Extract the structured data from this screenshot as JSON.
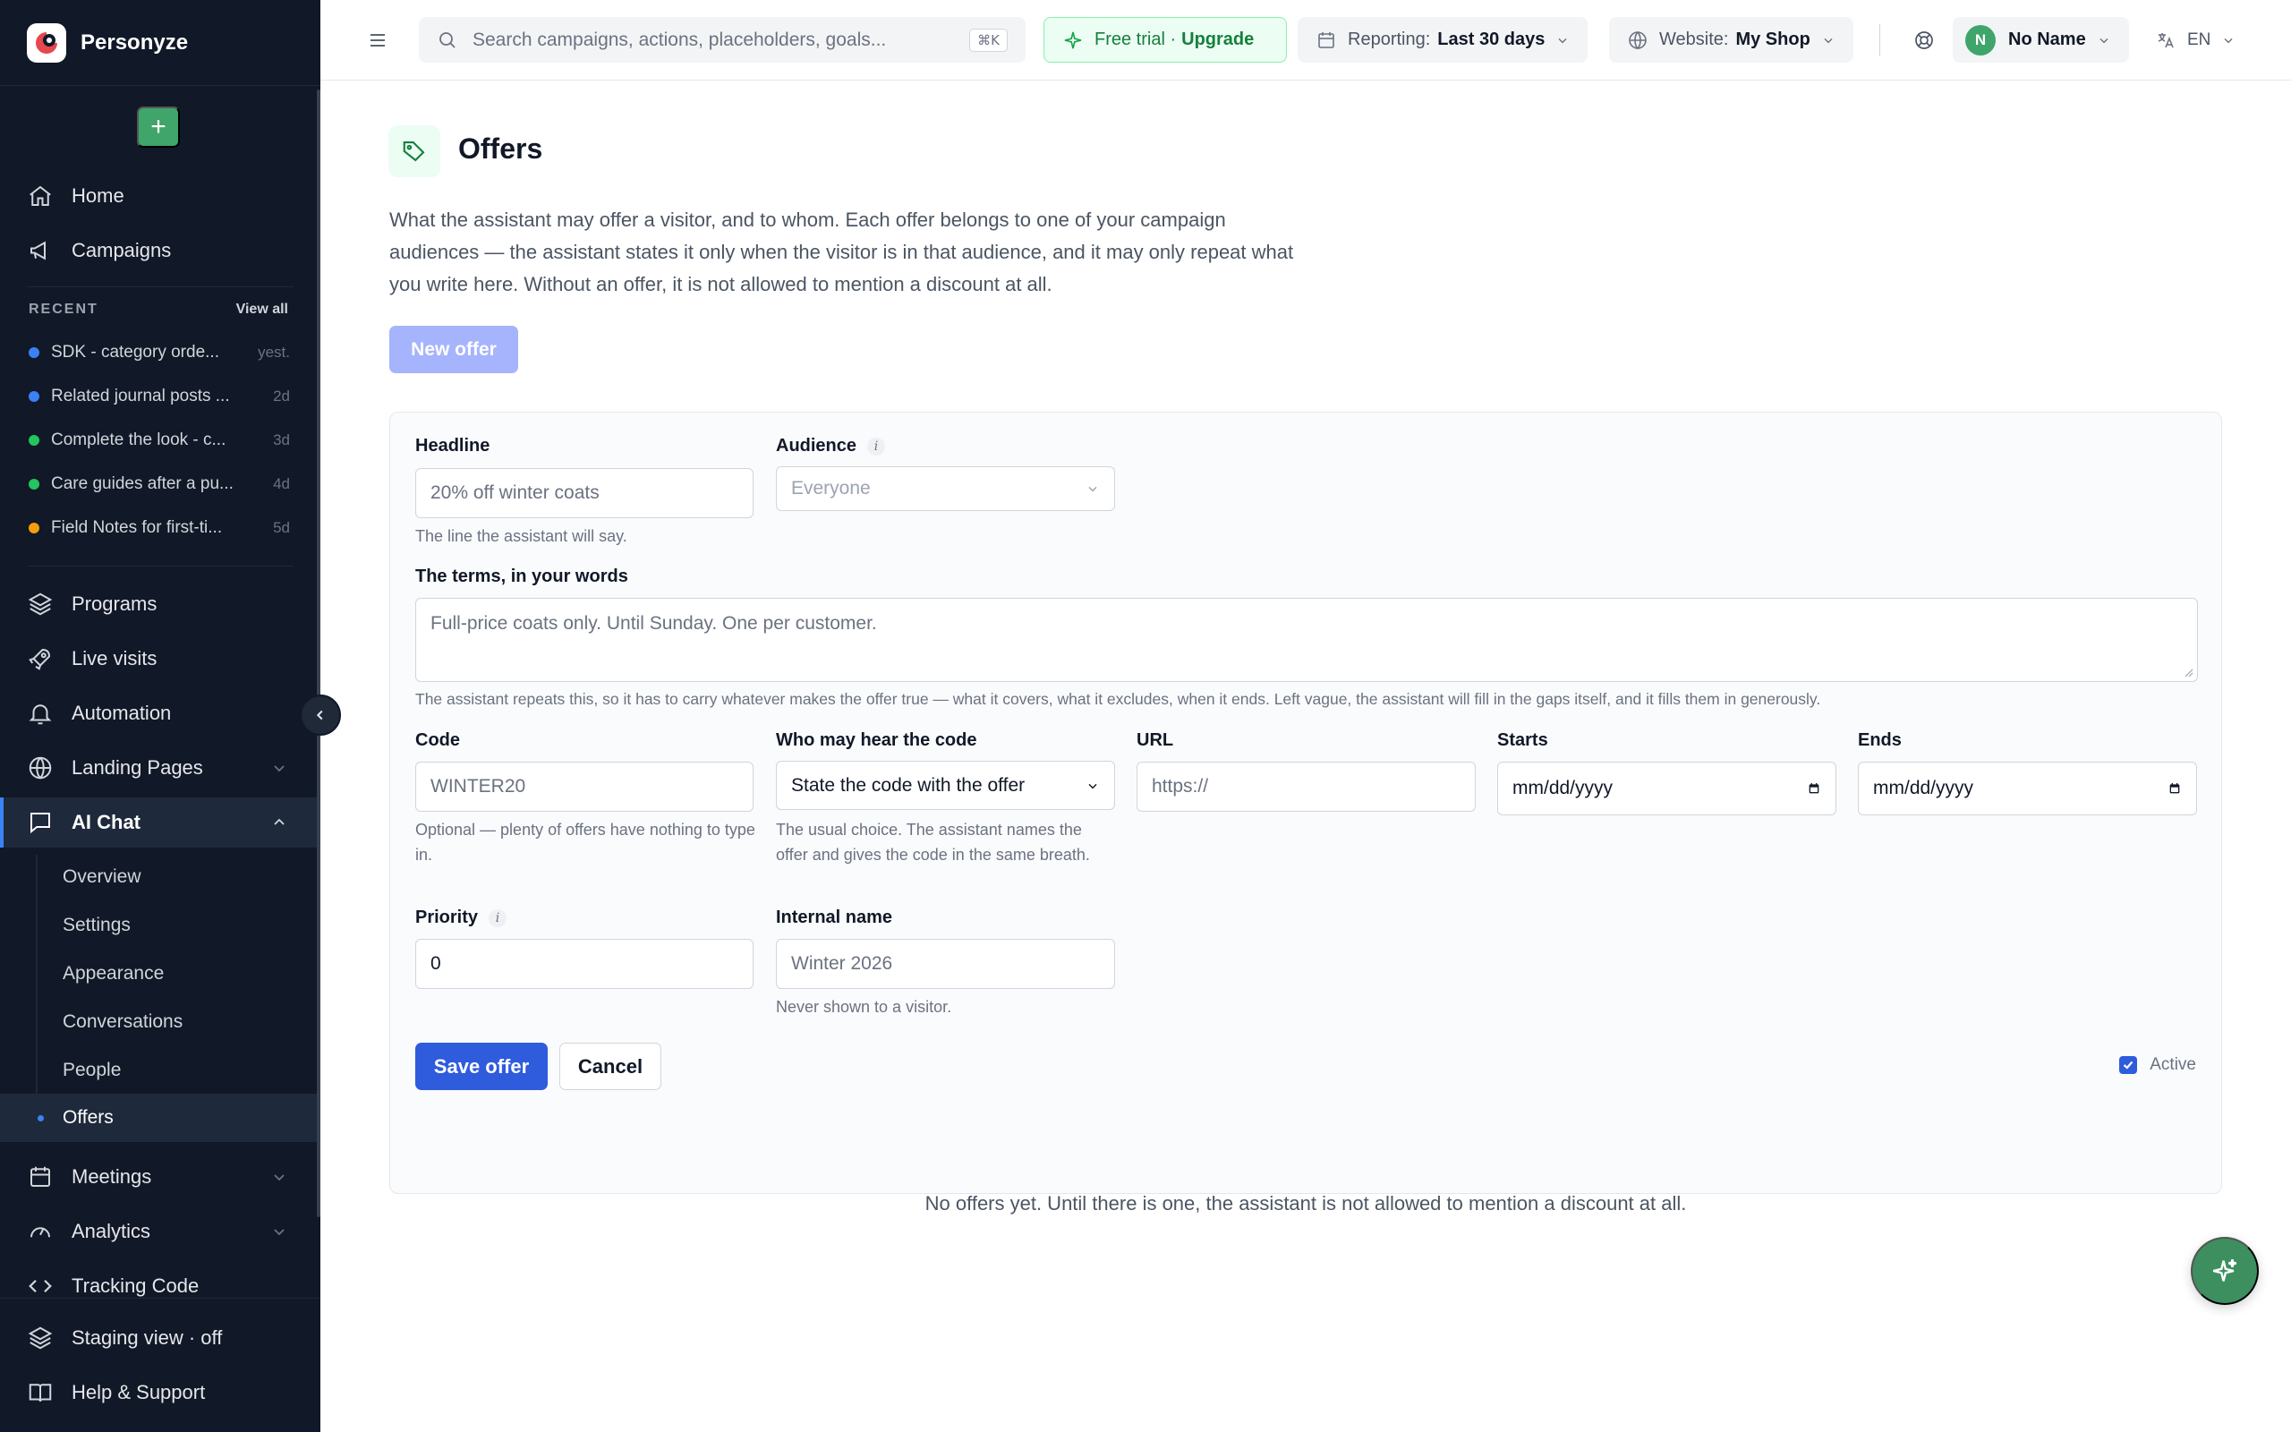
{
  "brand": {
    "name": "Personyze"
  },
  "sidebar": {
    "nav_top": [
      {
        "label": "Home",
        "icon": "home-icon"
      },
      {
        "label": "Campaigns",
        "icon": "megaphone-icon"
      }
    ],
    "recent": {
      "title": "RECENT",
      "view_all": "View all",
      "items": [
        {
          "label": "SDK - category orde...",
          "age": "yest.",
          "color": "#3b82f6"
        },
        {
          "label": "Related journal posts ...",
          "age": "2d",
          "color": "#3b82f6"
        },
        {
          "label": "Complete the look - c...",
          "age": "3d",
          "color": "#22c55e"
        },
        {
          "label": "Care guides after a pu...",
          "age": "4d",
          "color": "#22c55e"
        },
        {
          "label": "Field Notes for first-ti...",
          "age": "5d",
          "color": "#f59e0b"
        }
      ]
    },
    "nav_main": [
      {
        "label": "Programs",
        "icon": "layers-icon"
      },
      {
        "label": "Live visits",
        "icon": "rocket-icon"
      },
      {
        "label": "Automation",
        "icon": "bell-icon"
      },
      {
        "label": "Landing Pages",
        "icon": "globe-icon"
      },
      {
        "label": "AI Chat",
        "icon": "chat-icon"
      }
    ],
    "ai_chat_sub": [
      "Overview",
      "Settings",
      "Appearance",
      "Conversations",
      "People",
      "Offers"
    ],
    "nav_bottom": [
      {
        "label": "Meetings",
        "icon": "calendar-icon"
      },
      {
        "label": "Analytics",
        "icon": "gauge-icon"
      },
      {
        "label": "Tracking Code",
        "icon": "code-icon"
      },
      {
        "label": "Staging view · off",
        "icon": "layers-icon"
      },
      {
        "label": "Help & Support",
        "icon": "book-icon"
      }
    ]
  },
  "topbar": {
    "search_placeholder": "Search campaigns, actions, placeholders, goals...",
    "search_shortcut": "⌘K",
    "trial_label": "Free trial ·",
    "trial_upgrade": "Upgrade",
    "reporting_label": "Reporting:",
    "reporting_value": "Last 30 days",
    "website_label": "Website:",
    "website_value": "My Shop",
    "user_initial": "N",
    "user_name": "No Name",
    "language": "EN"
  },
  "page": {
    "title": "Offers",
    "description": "What the assistant may offer a visitor, and to whom. Each offer belongs to one of your campaign audiences — the assistant states it only when the visitor is in that audience, and it may only repeat what you write here. Without an offer, it is not allowed to mention a discount at all.",
    "new_offer_label": "New offer",
    "empty_message": "No offers yet. Until there is one, the assistant is not allowed to mention a discount at all."
  },
  "form": {
    "headline": {
      "label": "Headline",
      "placeholder": "20% off winter coats",
      "help": "The line the assistant will say."
    },
    "audience": {
      "label": "Audience",
      "value": "Everyone"
    },
    "terms": {
      "label": "The terms, in your words",
      "placeholder": "Full-price coats only. Until Sunday. One per customer.",
      "help": "The assistant repeats this, so it has to carry whatever makes the offer true — what it covers, what it excludes, when it ends. Left vague, the assistant will fill in the gaps itself, and it fills them in generously."
    },
    "code": {
      "label": "Code",
      "placeholder": "WINTER20",
      "help": "Optional — plenty of offers have nothing to type in."
    },
    "who_hears": {
      "label": "Who may hear the code",
      "value": "State the code with the offer",
      "help": "The usual choice. The assistant names the offer and gives the code in the same breath."
    },
    "url": {
      "label": "URL",
      "placeholder": "https://"
    },
    "starts": {
      "label": "Starts",
      "placeholder": "mm/dd/yyyy"
    },
    "ends": {
      "label": "Ends",
      "placeholder": "mm/dd/yyyy"
    },
    "priority": {
      "label": "Priority",
      "value": "0"
    },
    "internal_name": {
      "label": "Internal name",
      "placeholder": "Winter 2026",
      "help": "Never shown to a visitor."
    },
    "save_label": "Save offer",
    "cancel_label": "Cancel",
    "active_label": "Active"
  },
  "colors": {
    "accent": "#2f5bdd",
    "brand_green": "#3fa56a",
    "sidebar_bg": "#111827"
  }
}
